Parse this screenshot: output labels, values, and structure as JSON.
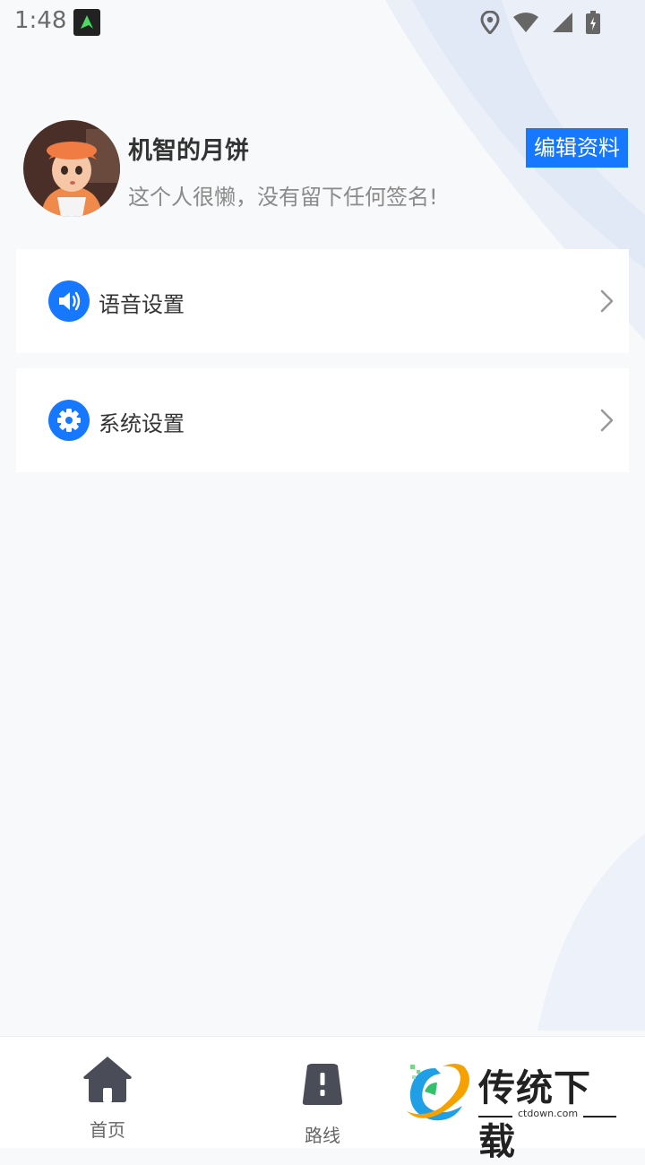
{
  "status_bar": {
    "time": "1:48"
  },
  "profile": {
    "nickname": "机智的月饼",
    "signature": "这个人很懒，没有留下任何签名!",
    "edit_label": "编辑资料"
  },
  "settings": [
    {
      "label": "语音设置",
      "icon": "speaker-icon"
    },
    {
      "label": "系统设置",
      "icon": "gear-icon"
    }
  ],
  "bottom_nav": [
    {
      "label": "首页",
      "icon": "home-icon"
    },
    {
      "label": "路线",
      "icon": "route-icon"
    }
  ],
  "watermark": {
    "brand": "传统下载",
    "url": "ctdown.com"
  },
  "colors": {
    "accent": "#1677ff",
    "background": "#f8f9fa"
  }
}
